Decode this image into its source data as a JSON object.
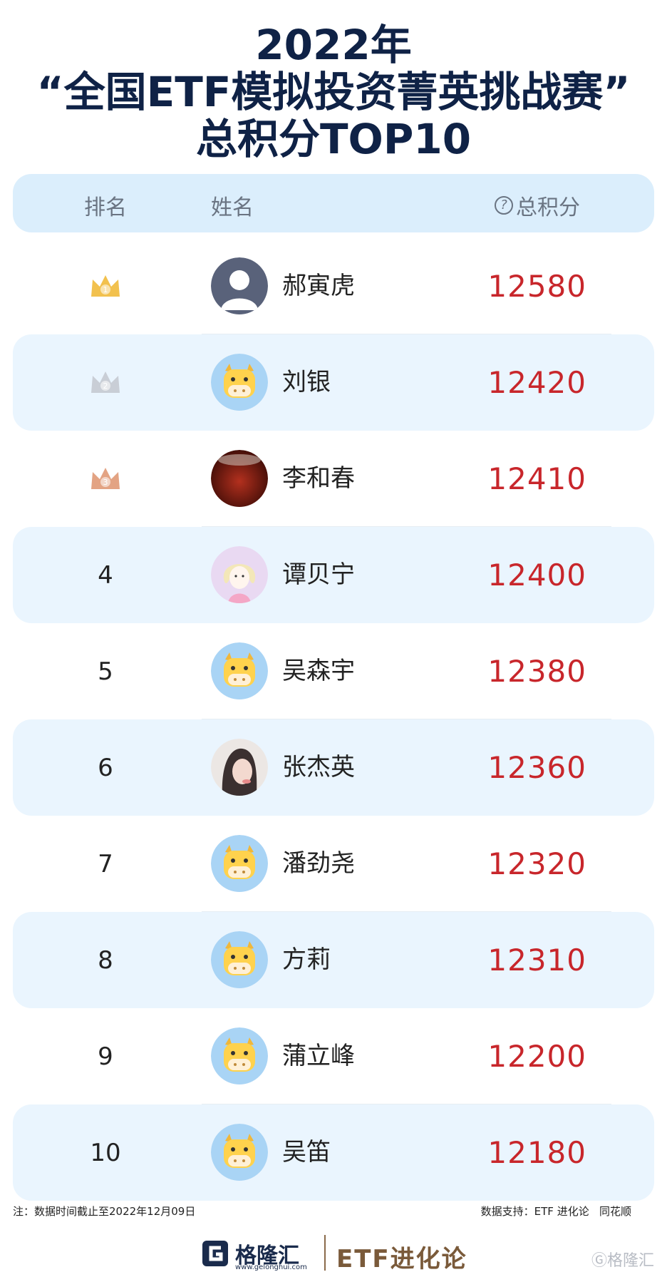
{
  "title": {
    "line1": "2022年",
    "line2": "“全国ETF模拟投资菁英挑战赛”",
    "line3": "总积分TOP10"
  },
  "header": {
    "rank_label": "排名",
    "name_label": "姓名",
    "score_icon": "question-circle-icon",
    "score_label": "总积分"
  },
  "rows": [
    {
      "rank": "1",
      "name": "郝寅虎",
      "score": "12580",
      "avatar": "default-person"
    },
    {
      "rank": "2",
      "name": "刘银",
      "score": "12420",
      "avatar": "cow"
    },
    {
      "rank": "3",
      "name": "李和春",
      "score": "12410",
      "avatar": "photo-red"
    },
    {
      "rank": "4",
      "name": "谭贝宁",
      "score": "12400",
      "avatar": "cartoon-girl"
    },
    {
      "rank": "5",
      "name": "吴森宇",
      "score": "12380",
      "avatar": "cow"
    },
    {
      "rank": "6",
      "name": "张杰英",
      "score": "12360",
      "avatar": "photo-girl"
    },
    {
      "rank": "7",
      "name": "潘劲尧",
      "score": "12320",
      "avatar": "cow"
    },
    {
      "rank": "8",
      "name": "方莉",
      "score": "12310",
      "avatar": "cow"
    },
    {
      "rank": "9",
      "name": "蒲立峰",
      "score": "12200",
      "avatar": "cow"
    },
    {
      "rank": "10",
      "name": "吴笛",
      "score": "12180",
      "avatar": "cow"
    }
  ],
  "footer": {
    "note": "注：数据时间截止至2022年12月09日",
    "support": "数据支持：ETF 进化论   同花顺",
    "logo_main": "格隆汇",
    "logo_url": "www.gelonghui.com",
    "logo_etf": "ETF进化论",
    "watermark": "格隆汇"
  },
  "colors": {
    "title": "#0f2246",
    "score": "#c8262b",
    "header_bg": "#dbeefc",
    "row_shade": "#eaf5fe",
    "gold": "#f2c14e",
    "silver": "#c9ced6",
    "bronze": "#e3a383"
  }
}
